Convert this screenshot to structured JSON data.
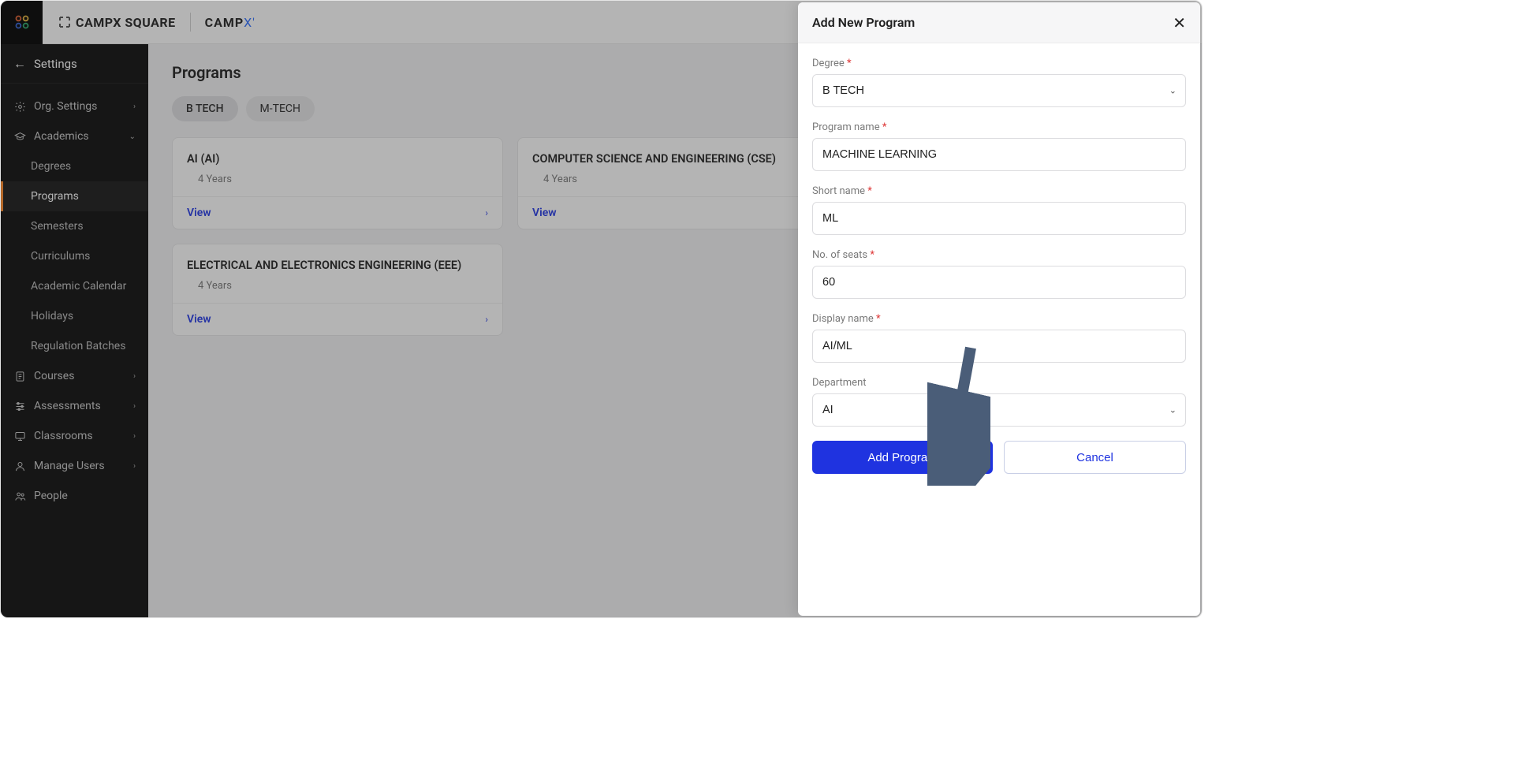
{
  "brand": {
    "name1": "CAMPX SQUARE",
    "name2_a": "CAMP",
    "name2_b": "X"
  },
  "settings_label": "Settings",
  "sidebar": {
    "org_settings": "Org. Settings",
    "academics": "Academics",
    "academics_children": {
      "degrees": "Degrees",
      "programs": "Programs",
      "semesters": "Semesters",
      "curriculums": "Curriculums",
      "academic_calendar": "Academic Calendar",
      "holidays": "Holidays",
      "regulation_batches": "Regulation Batches"
    },
    "courses": "Courses",
    "assessments": "Assessments",
    "classrooms": "Classrooms",
    "manage_users": "Manage Users",
    "people": "People"
  },
  "page": {
    "title": "Programs",
    "tabs": {
      "btech": "B TECH",
      "mtech": "M-TECH"
    },
    "cards": [
      {
        "title": "AI (AI)",
        "meta": "4 Years",
        "view": "View"
      },
      {
        "title": "COMPUTER SCIENCE AND ENGINEERING (CSE)",
        "meta": "4 Years",
        "view": "View"
      },
      {
        "title": "ELECTRICAL AND ELECTRONICS ENGINEERING (EEE)",
        "meta": "4 Years",
        "view": "View"
      }
    ]
  },
  "drawer": {
    "title": "Add New Program",
    "labels": {
      "degree": "Degree",
      "program_name": "Program name",
      "short_name": "Short name",
      "seats": "No. of seats",
      "display_name": "Display name",
      "department": "Department"
    },
    "values": {
      "degree": "B TECH",
      "program_name": "MACHINE LEARNING",
      "short_name": "ML",
      "seats": "60",
      "display_name": "AI/ML",
      "department": "AI"
    },
    "buttons": {
      "add": "Add Program",
      "cancel": "Cancel"
    }
  }
}
